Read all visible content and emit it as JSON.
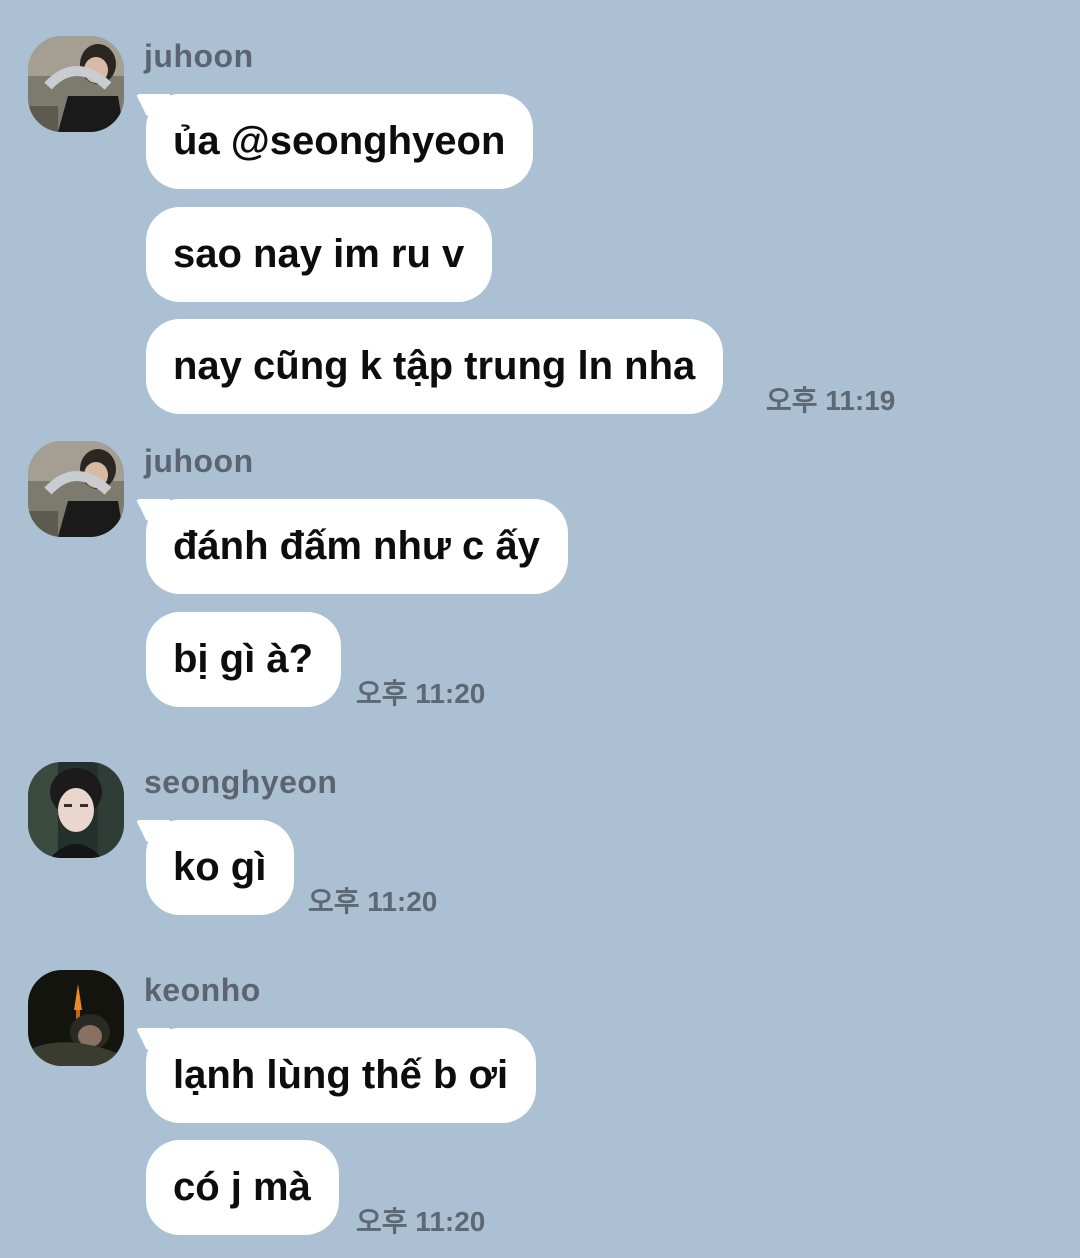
{
  "chat": {
    "groups": [
      {
        "sender": "juhoon",
        "avatar_icon": "juhoon-avatar-photo",
        "messages": [
          "ủa @seonghyeon",
          "sao nay im ru v",
          "nay cũng k tập trung ln nha"
        ],
        "time": "오후 11:19"
      },
      {
        "sender": "juhoon",
        "avatar_icon": "juhoon-avatar-photo",
        "messages": [
          "đánh đấm như c ấy",
          "bị gì à?"
        ],
        "time": "오후 11:20"
      },
      {
        "sender": "seonghyeon",
        "avatar_icon": "seonghyeon-avatar-photo",
        "messages": [
          "ko gì"
        ],
        "time": "오후 11:20"
      },
      {
        "sender": "keonho",
        "avatar_icon": "keonho-avatar-photo",
        "messages": [
          "lạnh lùng thế b ơi",
          "có j mà"
        ],
        "time": "오후 11:20"
      }
    ]
  },
  "colors": {
    "background": "#abc1d3",
    "bubble": "#ffffff",
    "sender_text": "#5b6470",
    "time_text": "#5e6873"
  }
}
